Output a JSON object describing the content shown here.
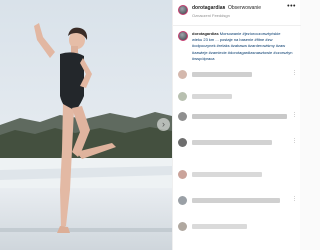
{
  "post": {
    "username": "dorotagardias",
    "separator": "•",
    "follow_label": "Obserwowanie",
    "subtitle": "Oznaczeni Feeddsgn",
    "more_icon": "more-dots-icon"
  },
  "caption": {
    "username": "dorotagardias",
    "lines": [
      "Morsowanie #jezioroczorsztyńskie",
      "wieku 23 km ... postaje na basenie #fitne #zw",
      "#odpoczynek #relaks #zabawa #zarderowiśmy #zaw",
      "#zawieje #zamiecie #dorotagardiasnasztowie #czorsztyn",
      "#wspólpraca"
    ]
  },
  "photo": {
    "next_icon": "chevron-right-icon",
    "next_glyph": "›"
  },
  "comments": {
    "count_visible": 6
  }
}
